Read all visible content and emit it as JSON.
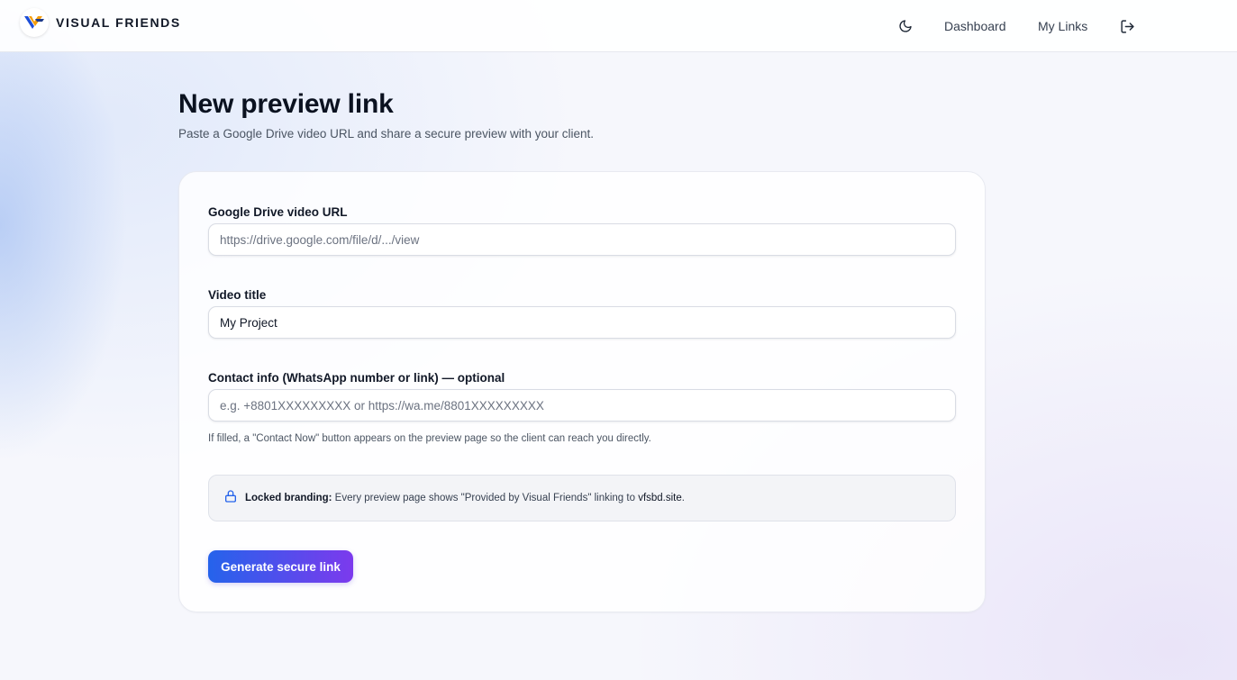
{
  "header": {
    "brand": "VISUAL FRIENDS",
    "nav": {
      "dashboard": "Dashboard",
      "my_links": "My Links"
    },
    "icons": {
      "theme_toggle": "moon-icon",
      "logout": "logout-icon",
      "logo": "vf-logo-icon"
    }
  },
  "page": {
    "title": "New preview link",
    "subtitle": "Paste a Google Drive video URL and share a secure preview with your client."
  },
  "form": {
    "drive_url": {
      "label": "Google Drive video URL",
      "placeholder": "https://drive.google.com/file/d/.../view",
      "value": ""
    },
    "video_title": {
      "label": "Video title",
      "value": "My Project",
      "placeholder": ""
    },
    "contact": {
      "label": "Contact info (WhatsApp number or link) — optional",
      "placeholder": "e.g. +8801XXXXXXXXX or https://wa.me/8801XXXXXXXXX",
      "value": ""
    },
    "contact_hint": "If filled, a \"Contact Now\" button appears on the preview page so the client can reach you directly.",
    "notice": {
      "strong": "Locked branding:",
      "text": " Every preview page shows \"Provided by Visual Friends\" linking to ",
      "site": "vfsbd.site",
      "end": "."
    },
    "submit_label": "Generate secure link"
  },
  "colors": {
    "accent_start": "#2563eb",
    "accent_end": "#7c3aed",
    "lock_icon": "#2563eb",
    "logo_orange": "#f59e0b",
    "logo_blue": "#1d4ed8"
  }
}
